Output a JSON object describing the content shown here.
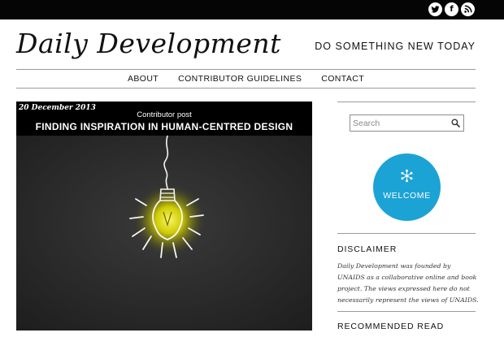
{
  "social": {
    "twitter": {
      "icon": "twitter-icon"
    },
    "facebook": {
      "icon": "facebook-icon",
      "glyph": "f"
    },
    "rss": {
      "icon": "rss-icon"
    }
  },
  "header": {
    "logo": "Daily Development",
    "tagline": "DO SOMETHING NEW TODAY"
  },
  "nav": {
    "items": [
      {
        "label": "ABOUT"
      },
      {
        "label": "CONTRIBUTOR GUIDELINES"
      },
      {
        "label": "CONTACT"
      }
    ]
  },
  "feature": {
    "date": "20 December 2013",
    "kicker": "Contributor post",
    "title": "FINDING INSPIRATION IN HUMAN-CENTRED DESIGN",
    "image_icon": "light-bulb-icon"
  },
  "sidebar": {
    "search": {
      "placeholder": "Search",
      "value": "",
      "icon": "search-icon"
    },
    "welcome": {
      "label": "WELCOME",
      "icon": "snowflake-icon",
      "color": "#1ca3d6"
    },
    "disclaimer": {
      "heading": "DISCLAIMER",
      "body": "Daily Development was founded by UNAIDS as a collaborative online and book project. The views expressed here do not necessarily represent the views of UNAIDS."
    },
    "recommended": {
      "heading": "RECOMMENDED READ"
    }
  },
  "colors": {
    "topbar": "#050505",
    "accent": "#1ca3d6",
    "bulb_glow": "#d9d600"
  }
}
